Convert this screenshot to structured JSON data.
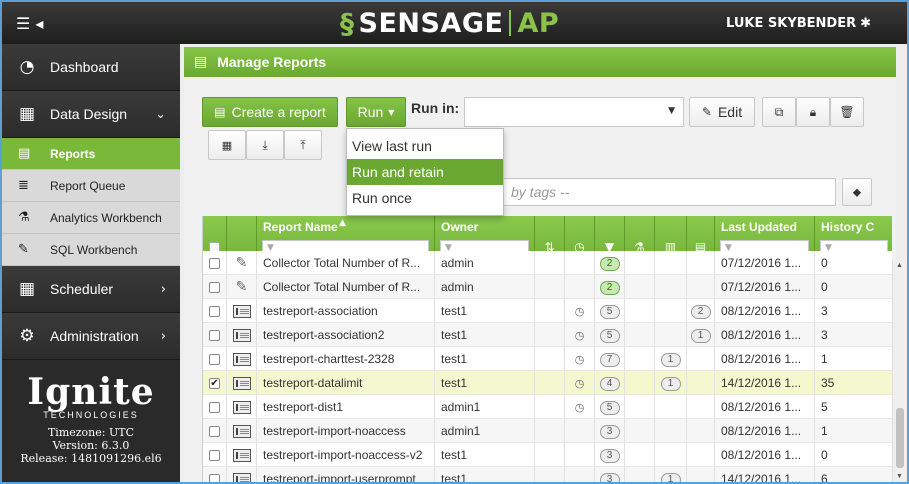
{
  "app": {
    "brand_name": "SENSAGE",
    "brand_suffix": "AP",
    "user": "LUKE SKYBENDER"
  },
  "sidebar": {
    "items": [
      {
        "label": "Dashboard"
      },
      {
        "label": "Data Design"
      },
      {
        "label": "Reports"
      },
      {
        "label": "Report Queue"
      },
      {
        "label": "Analytics Workbench"
      },
      {
        "label": "SQL Workbench"
      },
      {
        "label": "Scheduler"
      },
      {
        "label": "Administration"
      }
    ],
    "logo_text": "Ignite",
    "logo_sub": "TECHNOLOGIES",
    "timezone": "Timezone: UTC",
    "version": "Version: 6.3.0",
    "release": "Release: 1481091296.el6"
  },
  "page": {
    "title": "Manage Reports"
  },
  "toolbar": {
    "create_label": "Create a report",
    "run_label": "Run",
    "run_in_label": "Run in:",
    "run_in_value": "",
    "edit_label": "Edit"
  },
  "run_menu": {
    "items": [
      {
        "label": "View last run"
      },
      {
        "label": "Run and retain"
      },
      {
        "label": "Run once"
      }
    ]
  },
  "tags": {
    "placeholder": "by tags --"
  },
  "table": {
    "headers": {
      "name": "Report Name",
      "owner": "Owner",
      "updated": "Last Updated",
      "history": "History C"
    },
    "rows": [
      {
        "name": "Collector Total Number of R...",
        "owner": "admin",
        "runs": "2",
        "a": "",
        "b": "",
        "updated": "07/12/2016 1...",
        "history": "0",
        "checked": false,
        "clock": false,
        "type": "collector"
      },
      {
        "name": "Collector Total Number of R...",
        "owner": "admin",
        "runs": "2",
        "a": "",
        "b": "",
        "updated": "07/12/2016 1...",
        "history": "0",
        "checked": false,
        "clock": false,
        "type": "collector"
      },
      {
        "name": "testreport-association",
        "owner": "test1",
        "runs": "5",
        "a": "",
        "b": "2",
        "updated": "08/12/2016 1...",
        "history": "3",
        "checked": false,
        "clock": true,
        "type": "report"
      },
      {
        "name": "testreport-association2",
        "owner": "test1",
        "runs": "5",
        "a": "",
        "b": "1",
        "updated": "08/12/2016 1...",
        "history": "3",
        "checked": false,
        "clock": true,
        "type": "report"
      },
      {
        "name": "testreport-charttest-2328",
        "owner": "test1",
        "runs": "7",
        "a": "1",
        "b": "",
        "updated": "08/12/2016 1...",
        "history": "1",
        "checked": false,
        "clock": true,
        "type": "report"
      },
      {
        "name": "testreport-datalimit",
        "owner": "test1",
        "runs": "4",
        "a": "1",
        "b": "",
        "updated": "14/12/2016 1...",
        "history": "35",
        "checked": true,
        "clock": true,
        "type": "report"
      },
      {
        "name": "testreport-dist1",
        "owner": "admin1",
        "runs": "5",
        "a": "",
        "b": "",
        "updated": "08/12/2016 1...",
        "history": "5",
        "checked": false,
        "clock": true,
        "type": "report"
      },
      {
        "name": "testreport-import-noaccess",
        "owner": "admin1",
        "runs": "3",
        "a": "",
        "b": "",
        "updated": "08/12/2016 1...",
        "history": "1",
        "checked": false,
        "clock": false,
        "type": "report"
      },
      {
        "name": "testreport-import-noaccess-v2",
        "owner": "test1",
        "runs": "3",
        "a": "",
        "b": "",
        "updated": "08/12/2016 1...",
        "history": "0",
        "checked": false,
        "clock": false,
        "type": "report"
      },
      {
        "name": "testreport-import-userprompt",
        "owner": "test1",
        "runs": "3",
        "a": "1",
        "b": "",
        "updated": "14/12/2016 1...",
        "history": "6",
        "checked": false,
        "clock": false,
        "type": "report"
      }
    ]
  }
}
